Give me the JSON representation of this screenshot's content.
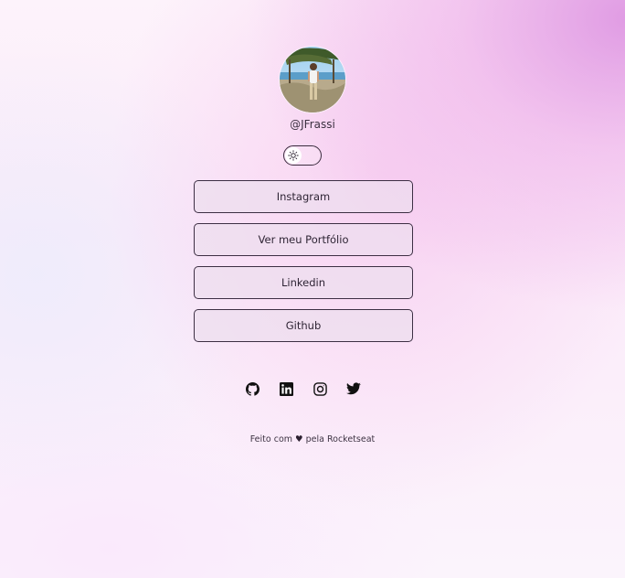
{
  "profile": {
    "username": "@JFrassi"
  },
  "theme_switch": {
    "icon": "sun-icon"
  },
  "links": [
    {
      "label": "Instagram"
    },
    {
      "label": "Ver meu Portfólio"
    },
    {
      "label": "Linkedin"
    },
    {
      "label": "Github"
    }
  ],
  "socials": [
    {
      "icon": "github-icon"
    },
    {
      "icon": "linkedin-icon"
    },
    {
      "icon": "instagram-icon"
    },
    {
      "icon": "twitter-icon"
    }
  ],
  "footer": {
    "prefix": "Feito com",
    "heart": "♥",
    "suffix": "pela Rocketseat"
  },
  "colors": {
    "accent": "#de96e2",
    "border": "#3d2f44"
  }
}
